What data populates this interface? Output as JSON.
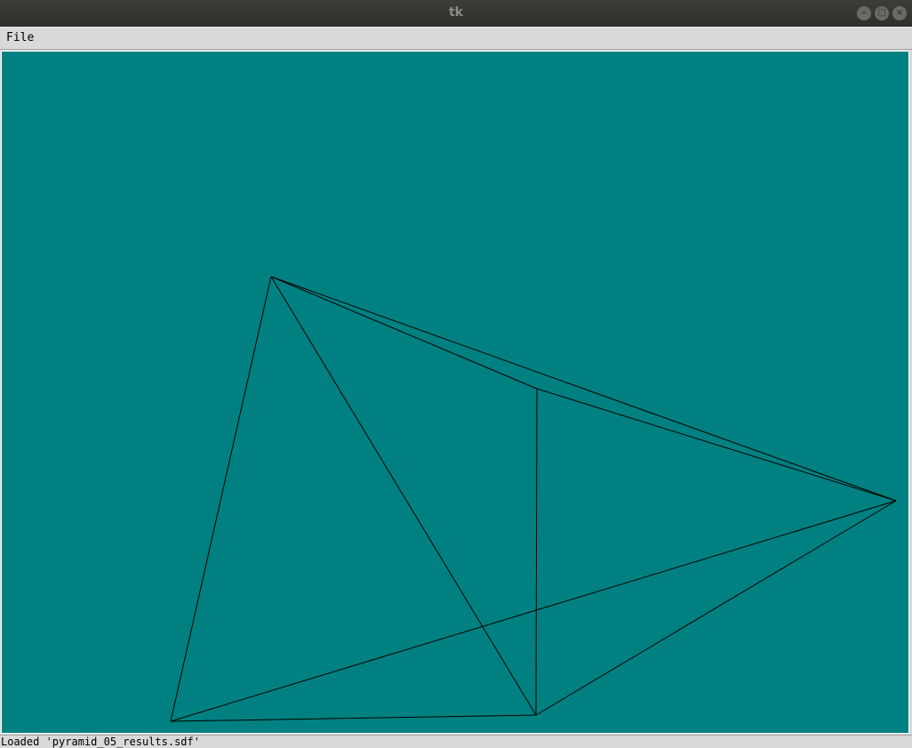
{
  "window": {
    "title": "tk",
    "controls": {
      "minimize_icon": "minimize-icon",
      "maximize_icon": "maximize-icon",
      "close_icon": "close-icon"
    }
  },
  "menubar": {
    "items": [
      {
        "label": "File"
      }
    ]
  },
  "canvas": {
    "background": "#008080",
    "line_color": "#000000"
  },
  "status": {
    "text": "Loaded 'pyramid_05_results.sdf'"
  }
}
